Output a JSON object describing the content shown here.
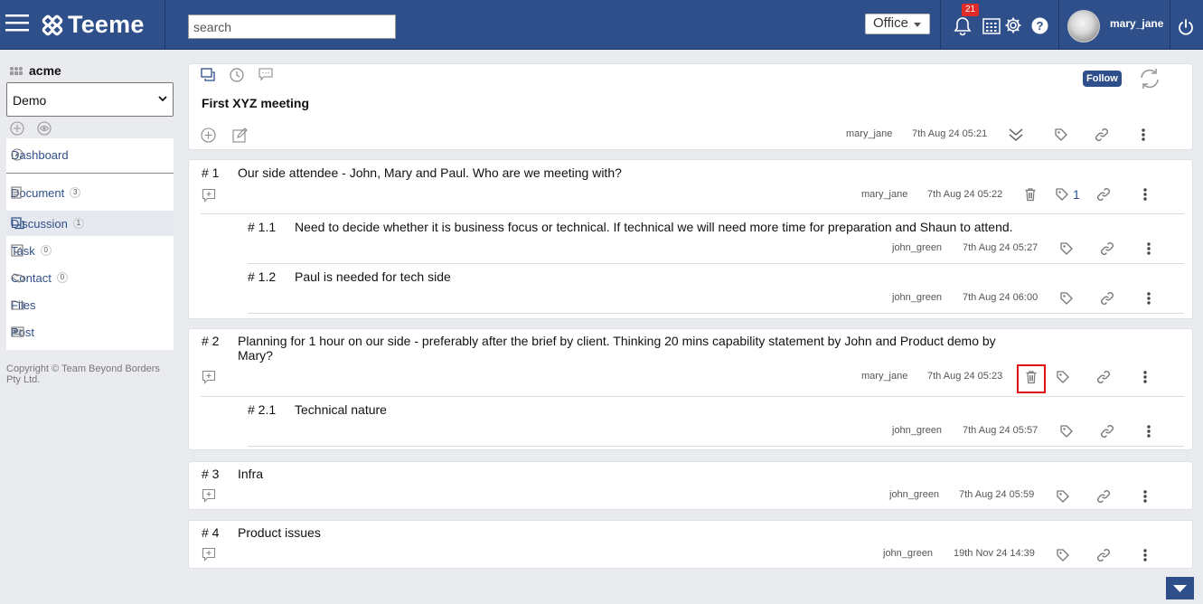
{
  "app": {
    "name": "Teeme",
    "notification_count": "21",
    "username": "mary_jane"
  },
  "header": {
    "search_placeholder": "search",
    "workspace_selector": "Office"
  },
  "sidebar": {
    "org_name": "acme",
    "space_selected": "Demo",
    "items": [
      {
        "label": "Dashboard",
        "count": null
      },
      {
        "label": "Document",
        "count": "3"
      },
      {
        "label": "Discussion",
        "count": "1"
      },
      {
        "label": "Task",
        "count": "0"
      },
      {
        "label": "Contact",
        "count": "0"
      },
      {
        "label": "Files",
        "count": null
      },
      {
        "label": "Post",
        "count": null
      }
    ],
    "copyright": "Copyright © Team Beyond Borders Pty Ltd."
  },
  "topic": {
    "title": "First XYZ meeting",
    "follow_label": "Follow",
    "author": "mary_jane",
    "timestamp": "7th Aug 24 05:21"
  },
  "posts": [
    {
      "number": "# 1",
      "text": "Our side attendee - John, Mary and Paul. Who are we meeting with?",
      "author": "mary_jane",
      "timestamp": "7th Aug 24 05:22",
      "tag_count": "1",
      "replies": [
        {
          "number": "# 1.1",
          "text": "Need to decide whether it is business focus or technical. If technical we will need more time for preparation and Shaun to attend.",
          "author": "john_green",
          "timestamp": "7th Aug 24 05:27"
        },
        {
          "number": "# 1.2",
          "text": "Paul is needed for tech side",
          "author": "john_green",
          "timestamp": "7th Aug 24 06:00"
        }
      ]
    },
    {
      "number": "# 2",
      "text_line1": "Planning for 1 hour on our side - preferably after the brief by client. Thinking 20 mins capability statement by John and Product demo by",
      "text_line2": "Mary?",
      "author": "mary_jane",
      "timestamp": "7th Aug 24 05:23",
      "replies": [
        {
          "number": "# 2.1",
          "text": "Technical nature",
          "author": "john_green",
          "timestamp": "7th Aug 24 05:57"
        }
      ]
    },
    {
      "number": "# 3",
      "text": "Infra",
      "author": "john_green",
      "timestamp": "7th Aug 24 05:59"
    },
    {
      "number": "# 4",
      "text": "Product issues",
      "author": "john_green",
      "timestamp": "19th Nov 24 14:39"
    }
  ],
  "colors": {
    "header_bg": "#2f4f8a",
    "accent": "#2f4f8a",
    "highlight": "#e01010",
    "badge": "#e02b27"
  }
}
